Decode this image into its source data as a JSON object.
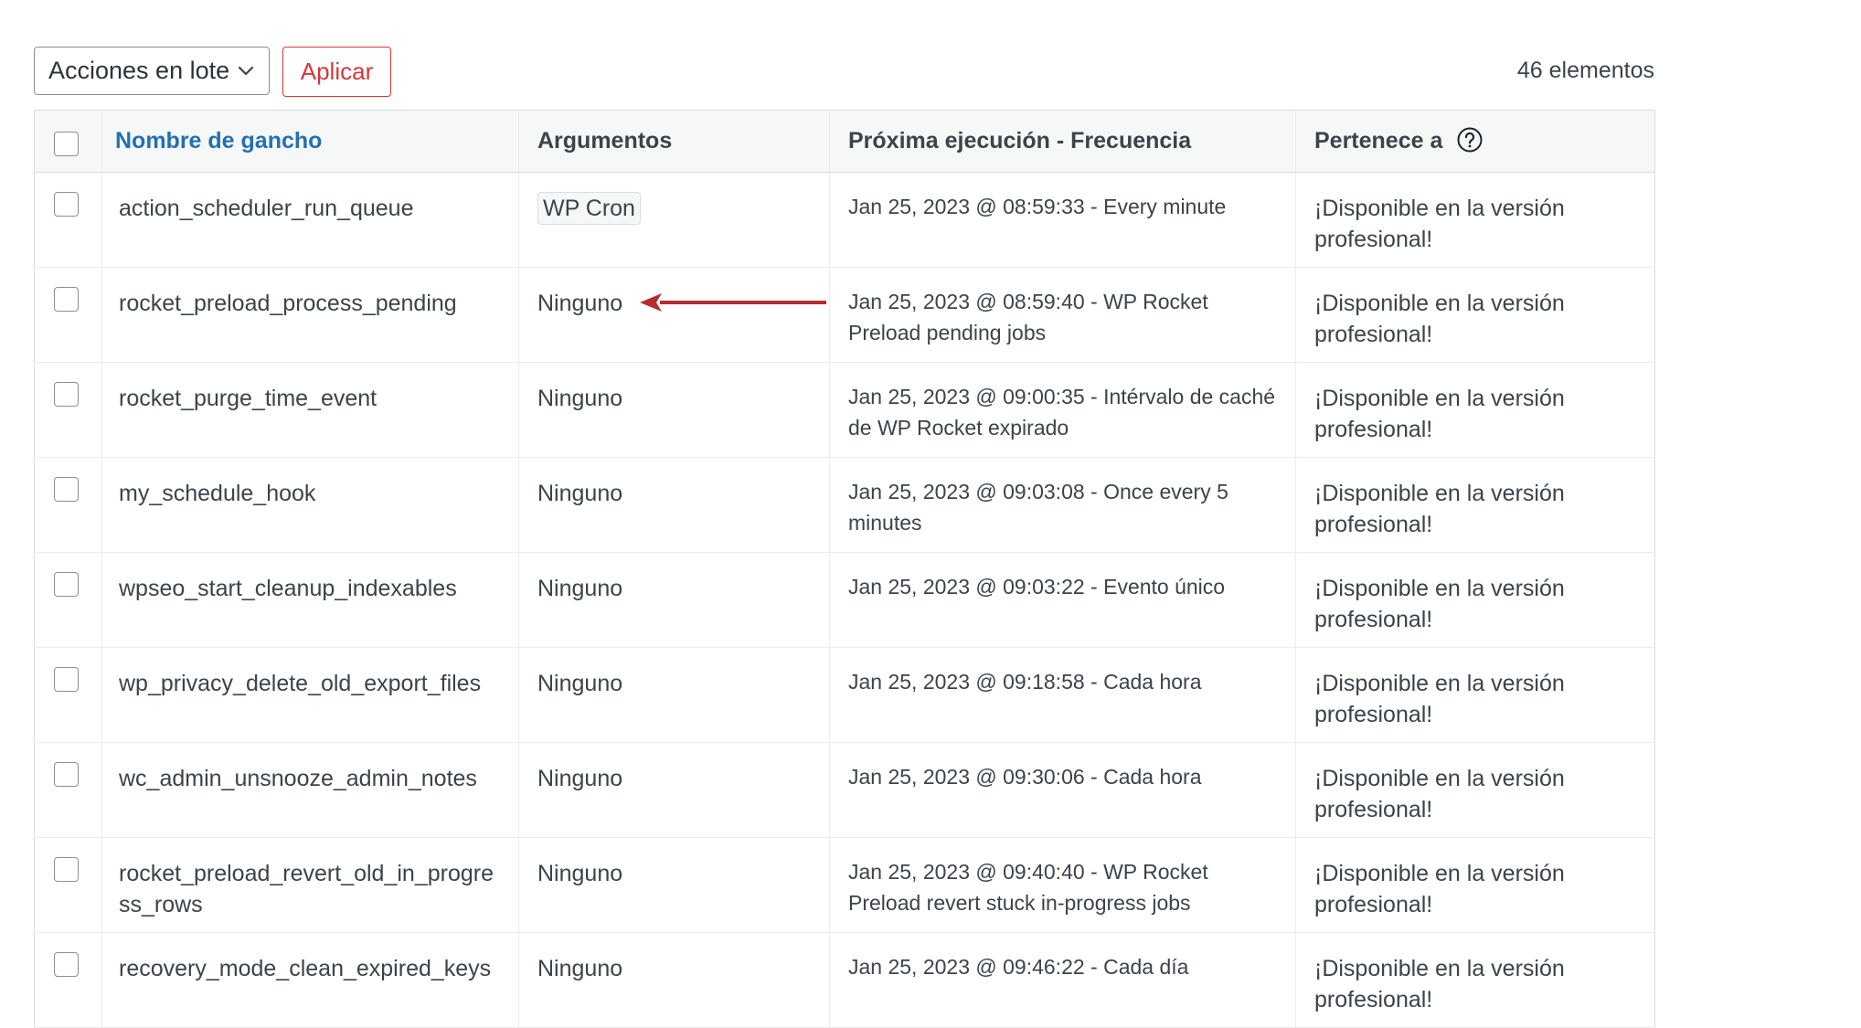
{
  "toolbar": {
    "bulk_actions_label": "Acciones en lote",
    "apply_label": "Aplicar",
    "item_count": "46 elementos"
  },
  "table": {
    "headers": {
      "hook": "Nombre de gancho",
      "arguments": "Argumentos",
      "next_run": "Próxima ejecución - Frecuencia",
      "belongs_to": "Pertenece a"
    },
    "rows": [
      {
        "hook": "action_scheduler_run_queue",
        "arguments": "WP Cron",
        "next_run": "Jan 25, 2023 @ 08:59:33 - Every minute",
        "belongs_to": "¡Disponible en la versión profesional!"
      },
      {
        "hook": "rocket_preload_process_pending",
        "arguments": "Ninguno",
        "next_run": "Jan 25, 2023 @ 08:59:40 - WP Rocket Preload pending jobs",
        "belongs_to": "¡Disponible en la versión profesional!"
      },
      {
        "hook": "rocket_purge_time_event",
        "arguments": "Ninguno",
        "next_run": "Jan 25, 2023 @ 09:00:35 - Intérvalo de caché de WP Rocket expirado",
        "belongs_to": "¡Disponible en la versión profesional!"
      },
      {
        "hook": "my_schedule_hook",
        "arguments": "Ninguno",
        "next_run": "Jan 25, 2023 @ 09:03:08 - Once every 5 minutes",
        "belongs_to": "¡Disponible en la versión profesional!"
      },
      {
        "hook": "wpseo_start_cleanup_indexables",
        "arguments": "Ninguno",
        "next_run": "Jan 25, 2023 @ 09:03:22 - Evento único",
        "belongs_to": "¡Disponible en la versión profesional!"
      },
      {
        "hook": "wp_privacy_delete_old_export_files",
        "arguments": "Ninguno",
        "next_run": "Jan 25, 2023 @ 09:18:58 - Cada hora",
        "belongs_to": "¡Disponible en la versión profesional!"
      },
      {
        "hook": "wc_admin_unsnooze_admin_notes",
        "arguments": "Ninguno",
        "next_run": "Jan 25, 2023 @ 09:30:06 - Cada hora",
        "belongs_to": "¡Disponible en la versión profesional!"
      },
      {
        "hook": "rocket_preload_revert_old_in_progress_rows",
        "arguments": "Ninguno",
        "next_run": "Jan 25, 2023 @ 09:40:40 - WP Rocket Preload revert stuck in-progress jobs",
        "belongs_to": "¡Disponible en la versión profesional!"
      },
      {
        "hook": "recovery_mode_clean_expired_keys",
        "arguments": "Ninguno",
        "next_run": "Jan 25, 2023 @ 09:46:22 - Cada día",
        "belongs_to": "¡Disponible en la versión profesional!"
      }
    ]
  },
  "icons": {
    "dropdown": "chevron-down-icon",
    "help": "question-circle-icon",
    "annotation": "red-arrow-icon"
  },
  "colors": {
    "link_blue": "#2271b1",
    "apply_red": "#d63638",
    "arrow_red": "#b32d2e",
    "muted_text": "#8c8f94"
  }
}
